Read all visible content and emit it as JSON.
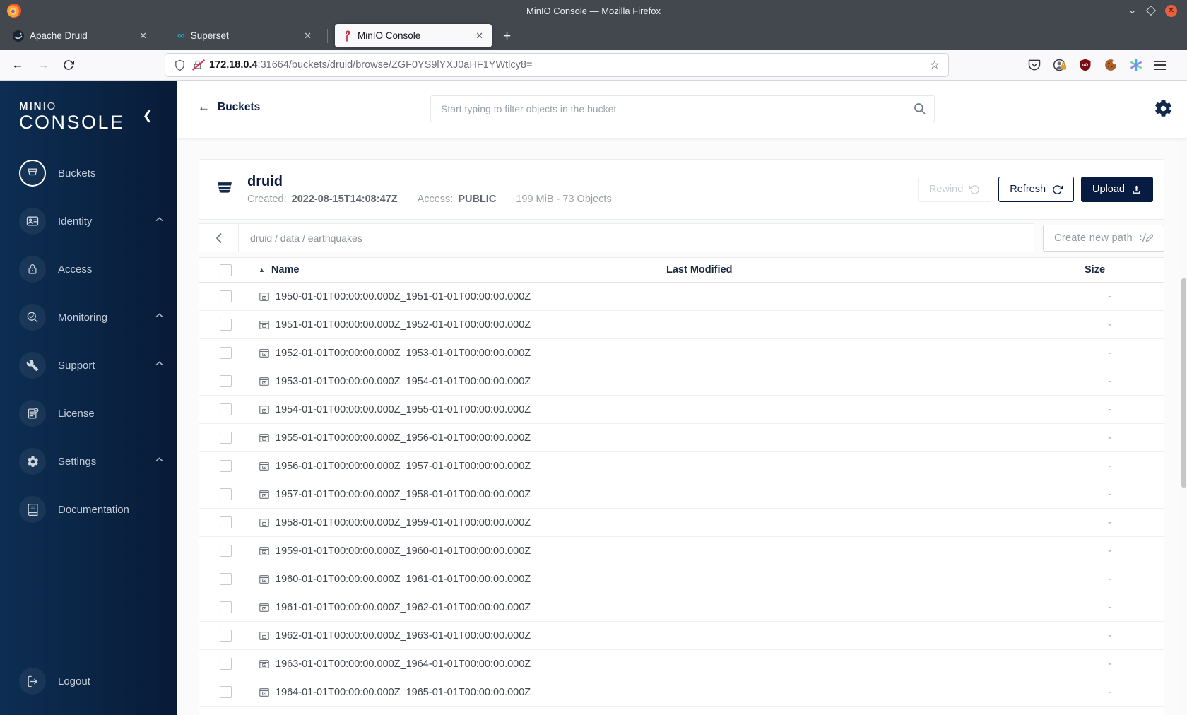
{
  "window": {
    "title": "MinIO Console — Mozilla Firefox"
  },
  "tabs": [
    {
      "label": "Apache Druid"
    },
    {
      "label": "Superset"
    },
    {
      "label": "MinIO Console"
    }
  ],
  "urlbar": {
    "host": "172.18.0.4",
    "path": ":31664/buckets/druid/browse/ZGF0YS9lYXJ0aHF1YWtlcy8="
  },
  "sidebar": {
    "logo_strong": "MIN",
    "logo_light": "IO",
    "logo_sub": "CONSOLE",
    "items": [
      {
        "label": "Buckets",
        "selected": true
      },
      {
        "label": "Identity",
        "expandable": true
      },
      {
        "label": "Access"
      },
      {
        "label": "Monitoring",
        "expandable": true
      },
      {
        "label": "Support",
        "expandable": true
      },
      {
        "label": "License"
      },
      {
        "label": "Settings",
        "expandable": true
      },
      {
        "label": "Documentation"
      }
    ],
    "logout_label": "Logout"
  },
  "header": {
    "back_label": "Buckets",
    "search_placeholder": "Start typing to filter objects in the bucket"
  },
  "bucket": {
    "name": "druid",
    "created_label": "Created:",
    "created_value": "2022-08-15T14:08:47Z",
    "access_label": "Access:",
    "access_value": "PUBLIC",
    "stats": "199 MiB - 73 Objects",
    "rewind_label": "Rewind",
    "refresh_label": "Refresh",
    "upload_label": "Upload"
  },
  "browse": {
    "path": "druid / data / earthquakes",
    "create_path_label": "Create new path"
  },
  "table": {
    "name_header": "Name",
    "modified_header": "Last Modified",
    "size_header": "Size",
    "rows": [
      {
        "name": "1950-01-01T00:00:00.000Z_1951-01-01T00:00:00.000Z",
        "size": "-"
      },
      {
        "name": "1951-01-01T00:00:00.000Z_1952-01-01T00:00:00.000Z",
        "size": "-"
      },
      {
        "name": "1952-01-01T00:00:00.000Z_1953-01-01T00:00:00.000Z",
        "size": "-"
      },
      {
        "name": "1953-01-01T00:00:00.000Z_1954-01-01T00:00:00.000Z",
        "size": "-"
      },
      {
        "name": "1954-01-01T00:00:00.000Z_1955-01-01T00:00:00.000Z",
        "size": "-"
      },
      {
        "name": "1955-01-01T00:00:00.000Z_1956-01-01T00:00:00.000Z",
        "size": "-"
      },
      {
        "name": "1956-01-01T00:00:00.000Z_1957-01-01T00:00:00.000Z",
        "size": "-"
      },
      {
        "name": "1957-01-01T00:00:00.000Z_1958-01-01T00:00:00.000Z",
        "size": "-"
      },
      {
        "name": "1958-01-01T00:00:00.000Z_1959-01-01T00:00:00.000Z",
        "size": "-"
      },
      {
        "name": "1959-01-01T00:00:00.000Z_1960-01-01T00:00:00.000Z",
        "size": "-"
      },
      {
        "name": "1960-01-01T00:00:00.000Z_1961-01-01T00:00:00.000Z",
        "size": "-"
      },
      {
        "name": "1961-01-01T00:00:00.000Z_1962-01-01T00:00:00.000Z",
        "size": "-"
      },
      {
        "name": "1962-01-01T00:00:00.000Z_1963-01-01T00:00:00.000Z",
        "size": "-"
      },
      {
        "name": "1963-01-01T00:00:00.000Z_1964-01-01T00:00:00.000Z",
        "size": "-"
      },
      {
        "name": "1964-01-01T00:00:00.000Z_1965-01-01T00:00:00.000Z",
        "size": "-"
      }
    ]
  },
  "colors": {
    "accent_navy": "#081C42",
    "sidebar_gradient_start": "#0D2E52",
    "sidebar_gradient_end": "#081B38",
    "superset_teal": "#20A7C9",
    "minio_red": "#C72C48",
    "ublock_red": "#7A0B12"
  }
}
